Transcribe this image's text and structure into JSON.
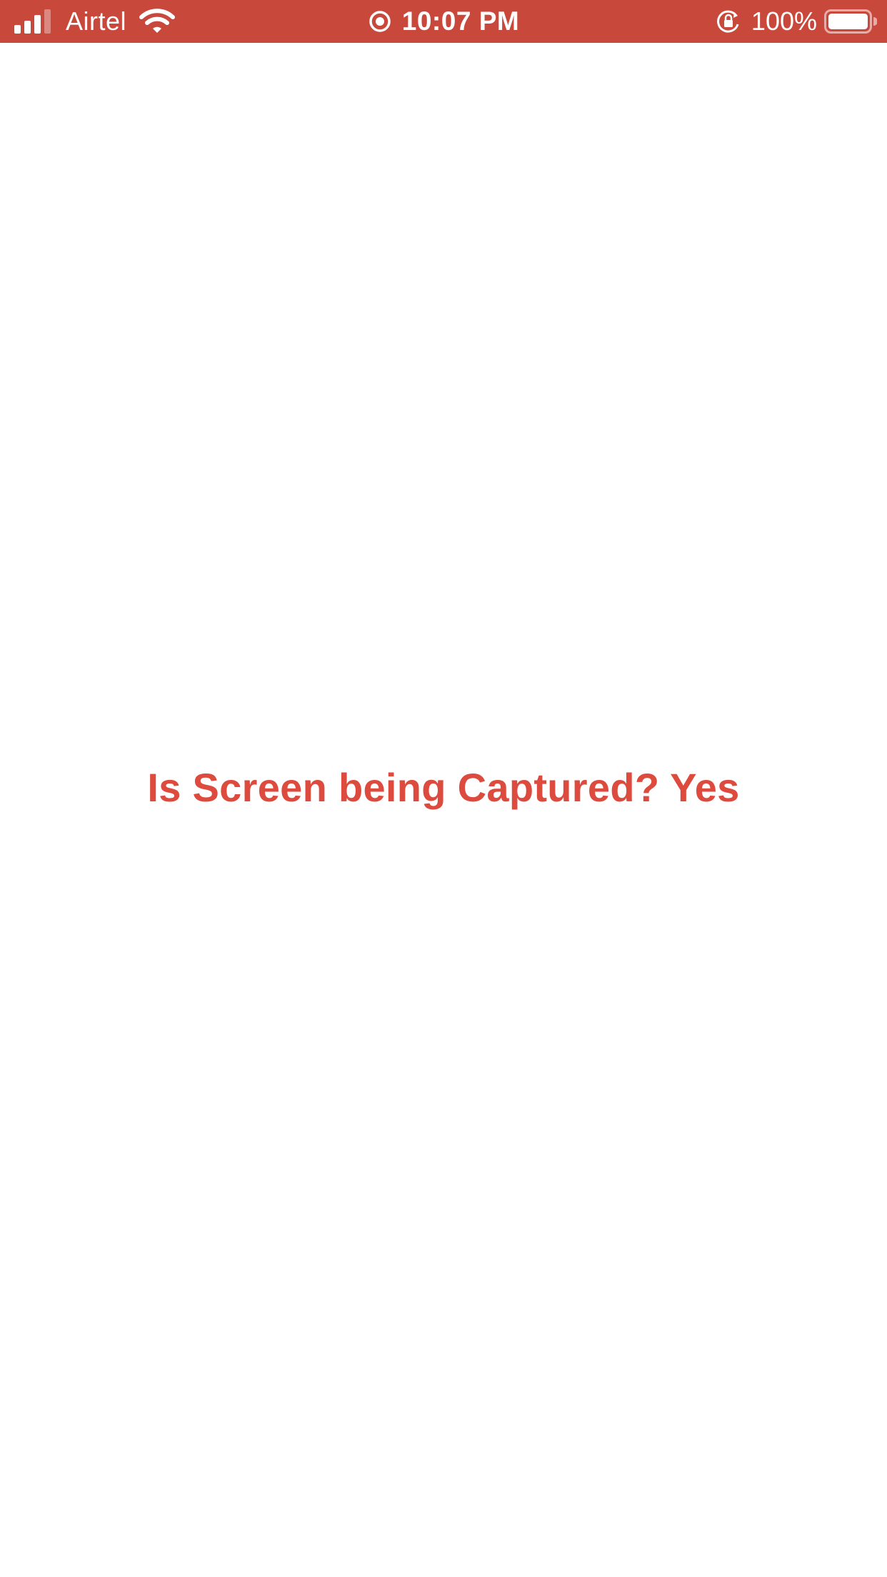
{
  "status_bar": {
    "carrier": "Airtel",
    "time": "10:07 PM",
    "battery_percent": "100%",
    "signal_bars_active": 3,
    "signal_bars_total": 4,
    "background_color": "#c9483c",
    "icons": {
      "signal": "cellular-signal-icon",
      "wifi": "wifi-icon",
      "recording": "screen-recording-icon",
      "orientation_lock": "orientation-lock-icon",
      "battery": "battery-icon"
    }
  },
  "main": {
    "capture_status_text": "Is Screen being Captured? Yes",
    "text_color": "#dd4a3e"
  }
}
